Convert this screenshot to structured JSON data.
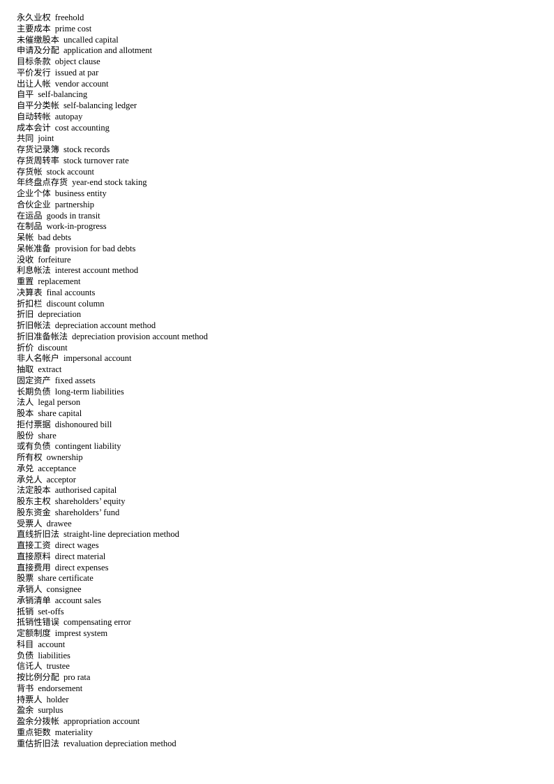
{
  "document": {
    "type": "glossary-list",
    "language_pair": "zh-en",
    "background_color": "#ffffff",
    "text_color": "#000000",
    "entry_count": 66
  },
  "entries": [
    {
      "term": "永久业权",
      "gloss": "freehold"
    },
    {
      "term": "主要成本",
      "gloss": "prime cost"
    },
    {
      "term": "未催缴股本",
      "gloss": "uncalled capital"
    },
    {
      "term": "申请及分配",
      "gloss": "application and allotment"
    },
    {
      "term": "目标条款",
      "gloss": "object clause"
    },
    {
      "term": "平价发行",
      "gloss": "issued at par"
    },
    {
      "term": "出让人帐",
      "gloss": "vendor account"
    },
    {
      "term": "自平",
      "gloss": "self-balancing"
    },
    {
      "term": "自平分类帐",
      "gloss": "self-balancing ledger"
    },
    {
      "term": "自动转帐",
      "gloss": "autopay"
    },
    {
      "term": "成本会计",
      "gloss": "cost accounting"
    },
    {
      "term": "共同",
      "gloss": "joint"
    },
    {
      "term": "存货记录簿",
      "gloss": "stock records"
    },
    {
      "term": "存货周转率",
      "gloss": "stock turnover rate"
    },
    {
      "term": "存货帐",
      "gloss": "stock account"
    },
    {
      "term": "年终盘点存货",
      "gloss": "year-end stock taking"
    },
    {
      "term": "企业个体",
      "gloss": "business entity"
    },
    {
      "term": "合伙企业",
      "gloss": "partnership"
    },
    {
      "term": "在运品",
      "gloss": "goods in transit"
    },
    {
      "term": "在制品",
      "gloss": "work-in-progress"
    },
    {
      "term": "呆帐",
      "gloss": "bad debts"
    },
    {
      "term": "呆帐准备",
      "gloss": "provision for bad debts"
    },
    {
      "term": "没收",
      "gloss": "forfeiture"
    },
    {
      "term": "利息帐法",
      "gloss": "interest account method"
    },
    {
      "term": "重置",
      "gloss": "replacement"
    },
    {
      "term": "决算表",
      "gloss": "final accounts"
    },
    {
      "term": "折扣栏",
      "gloss": "discount column"
    },
    {
      "term": "折旧",
      "gloss": "depreciation"
    },
    {
      "term": "折旧帐法",
      "gloss": "depreciation account method"
    },
    {
      "term": "折旧准备帐法",
      "gloss": "depreciation provision account method"
    },
    {
      "term": "折价",
      "gloss": "discount"
    },
    {
      "term": "非人名帐户",
      "gloss": "impersonal account"
    },
    {
      "term": "抽取",
      "gloss": "extract"
    },
    {
      "term": "固定资产",
      "gloss": "fixed assets"
    },
    {
      "term": "长期负债",
      "gloss": "long-term liabilities"
    },
    {
      "term": "法人",
      "gloss": "legal person"
    },
    {
      "term": "股本",
      "gloss": "share capital"
    },
    {
      "term": "拒付票据",
      "gloss": "dishonoured bill"
    },
    {
      "term": "股份",
      "gloss": "share"
    },
    {
      "term": "或有负债",
      "gloss": "contingent liability"
    },
    {
      "term": "所有权",
      "gloss": "ownership"
    },
    {
      "term": "承兑",
      "gloss": "acceptance"
    },
    {
      "term": "承兑人",
      "gloss": "acceptor"
    },
    {
      "term": "法定股本",
      "gloss": "authorised capital"
    },
    {
      "term": "股东主权",
      "gloss": "shareholders’ equity"
    },
    {
      "term": "股东资金",
      "gloss": "shareholders’ fund"
    },
    {
      "term": "受票人",
      "gloss": "drawee"
    },
    {
      "term": "直线折旧法",
      "gloss": "straight-line depreciation method"
    },
    {
      "term": "直接工资",
      "gloss": "direct wages"
    },
    {
      "term": "直接原料",
      "gloss": "direct material"
    },
    {
      "term": "直接费用",
      "gloss": "direct expenses"
    },
    {
      "term": "股票",
      "gloss": "share certificate"
    },
    {
      "term": "承销人",
      "gloss": "consignee"
    },
    {
      "term": "承销清单",
      "gloss": "account sales"
    },
    {
      "term": "抵销",
      "gloss": "set-offs"
    },
    {
      "term": "抵销性错误",
      "gloss": "compensating error"
    },
    {
      "term": "定额制度",
      "gloss": "imprest system"
    },
    {
      "term": "科目",
      "gloss": "account"
    },
    {
      "term": "负债",
      "gloss": "liabilities"
    },
    {
      "term": "信讬人",
      "gloss": "trustee"
    },
    {
      "term": "按比例分配",
      "gloss": "pro rata"
    },
    {
      "term": "背书",
      "gloss": "endorsement"
    },
    {
      "term": "持票人",
      "gloss": "holder"
    },
    {
      "term": "盈余",
      "gloss": "surplus"
    },
    {
      "term": "盈余分拨帐",
      "gloss": "appropriation account"
    },
    {
      "term": "重点钜数",
      "gloss": "materiality"
    },
    {
      "term": "重估折旧法",
      "gloss": "revaluation depreciation method"
    }
  ]
}
